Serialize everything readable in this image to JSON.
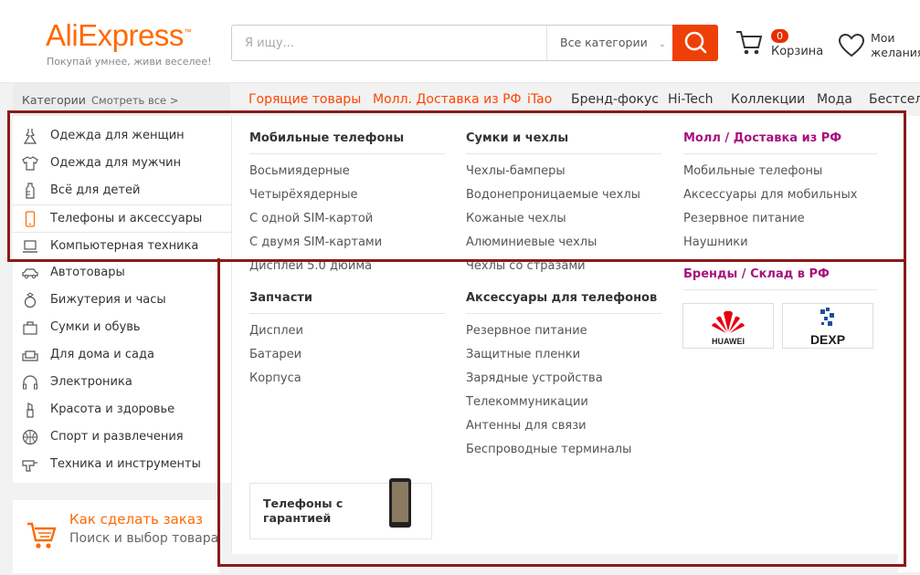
{
  "header": {
    "logo": "AliExpress",
    "tagline": "Покупай умнее, живи веселее!",
    "search_placeholder": "Я ищу...",
    "search_category": "Все категории",
    "cart_count": "0",
    "cart_label": "Корзина",
    "wishlist_label": "Мои желания"
  },
  "nav": {
    "categories_label": "Категории",
    "see_all": "Смотреть все >",
    "items": [
      "Горящие товары",
      "Молл. Доставка из РФ",
      "iTao",
      "Бренд-фокус",
      "Hi-Tech",
      "Коллекции",
      "Мода",
      "Бестселл"
    ]
  },
  "categories": [
    {
      "label": "Одежда для женщин",
      "icon": "dress-icon"
    },
    {
      "label": "Одежда для мужчин",
      "icon": "shirt-icon"
    },
    {
      "label": "Всё для детей",
      "icon": "bottle-icon"
    },
    {
      "label": "Телефоны и аксессуары",
      "icon": "phone-icon"
    },
    {
      "label": "Компьютерная техника",
      "icon": "laptop-icon"
    },
    {
      "label": "Автотовары",
      "icon": "car-icon"
    },
    {
      "label": "Бижутерия и часы",
      "icon": "ring-icon"
    },
    {
      "label": "Сумки и обувь",
      "icon": "bag-icon"
    },
    {
      "label": "Для дома и сада",
      "icon": "sofa-icon"
    },
    {
      "label": "Электроника",
      "icon": "headphones-icon"
    },
    {
      "label": "Красота и здоровье",
      "icon": "lipstick-icon"
    },
    {
      "label": "Спорт и развлечения",
      "icon": "ball-icon"
    },
    {
      "label": "Техника и инструменты",
      "icon": "drill-icon"
    }
  ],
  "dropdown": {
    "col1": {
      "h1": "Мобильные телефоны",
      "links1": [
        "Восьмиядерные",
        "Четырёхядерные",
        "С одной SIM-картой",
        "С двумя SIM-картами",
        "Дисплей 5.0 дюйма"
      ],
      "h2": "Запчасти",
      "links2": [
        "Дисплеи",
        "Батареи",
        "Корпуса"
      ]
    },
    "col2": {
      "h1": "Сумки и чехлы",
      "links1": [
        "Чехлы-бамперы",
        "Водонепроницаемые чехлы",
        "Кожаные чехлы",
        "Алюминиевые чехлы",
        "Чехлы со стразами"
      ],
      "h2": "Аксессуары для телефонов",
      "links2": [
        "Резервное питание",
        "Защитные пленки",
        "Зарядные устройства",
        "Телекоммуникации",
        "Антенны для связи",
        "Беспроводные терминалы"
      ]
    },
    "col3": {
      "h1": "Молл / Доставка из РФ",
      "links1": [
        "Мобильные телефоны",
        "Аксессуары для мобильных",
        "Резервное питание",
        "Наушники"
      ],
      "h2": "Бренды / Склад в РФ",
      "brands": [
        "HUAWEI",
        "DEXP"
      ]
    },
    "promo": "Телефоны с гарантией"
  },
  "bottom": {
    "title": "Как сделать заказ",
    "subtitle": "Поиск и выбор товара"
  },
  "colors": {
    "accent": "#ff6a00",
    "search_button": "#ee4006",
    "mall": "#a7127e",
    "outline": "#8b1a1a"
  }
}
